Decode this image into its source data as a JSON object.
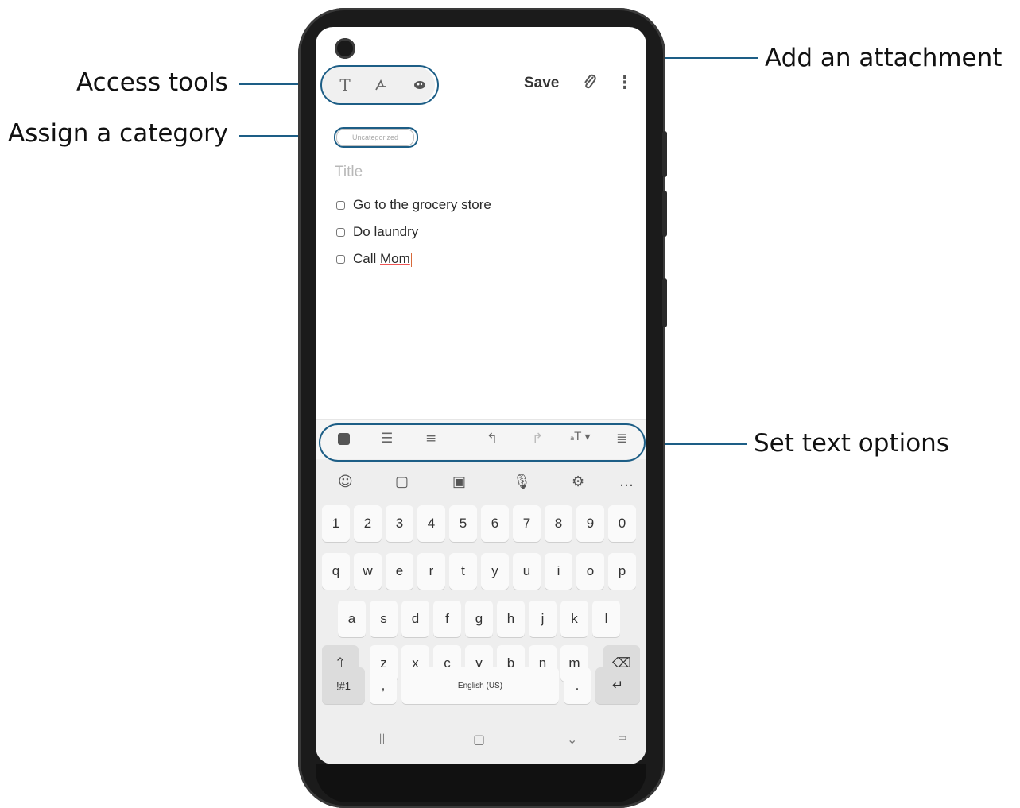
{
  "callouts": {
    "access_tools": "Access tools",
    "assign_category": "Assign a category",
    "add_attachment": "Add an attachment",
    "set_text_options": "Set text options"
  },
  "header": {
    "save_label": "Save",
    "tools": [
      "text-tool-icon",
      "pen-tool-icon",
      "brush-tool-icon"
    ]
  },
  "note": {
    "category": "Uncategorized",
    "title_placeholder": "Title",
    "items": [
      "Go to the grocery store",
      "Do laundry",
      "Call "
    ],
    "last_word": "Mom"
  },
  "keyboard": {
    "numbers": [
      "1",
      "2",
      "3",
      "4",
      "5",
      "6",
      "7",
      "8",
      "9",
      "0"
    ],
    "row1": [
      "q",
      "w",
      "e",
      "r",
      "t",
      "y",
      "u",
      "i",
      "o",
      "p"
    ],
    "row2": [
      "a",
      "s",
      "d",
      "f",
      "g",
      "h",
      "j",
      "k",
      "l"
    ],
    "row3": [
      "z",
      "x",
      "c",
      "v",
      "b",
      "n",
      "m"
    ],
    "symbols_label": "!#1",
    "comma": ",",
    "space_label": "English (US)",
    "period": "."
  },
  "colors": {
    "callout_line": "#1d5e86",
    "phone_frame": "#1b1b1b"
  }
}
